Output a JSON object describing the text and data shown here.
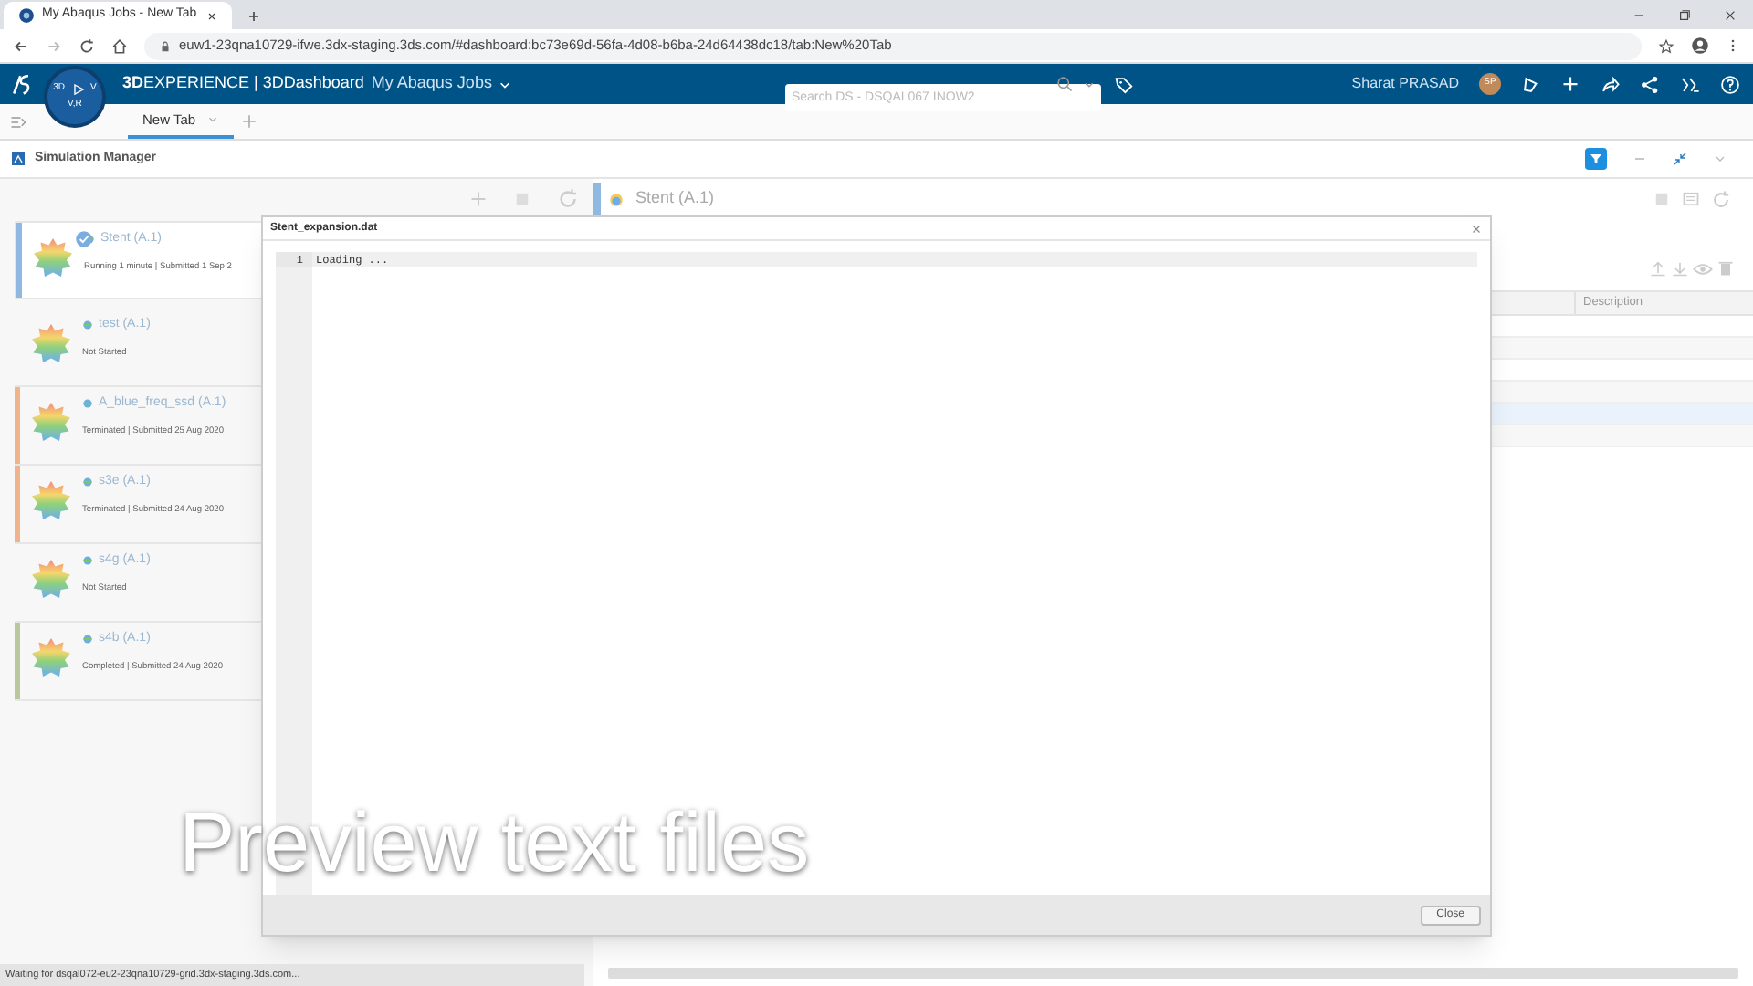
{
  "browser": {
    "tab_title": "My Abaqus Jobs - New Tab",
    "url": "euw1-23qna10729-ifwe.3dx-staging.3ds.com/#dashboard:bc73e69d-56fa-4d08-b6ba-24d64438dc18/tab:New%20Tab"
  },
  "topbar": {
    "brand_bold": "3D",
    "brand_rest": "EXPERIENCE | 3DDashboard",
    "dashboard": "My Abaqus Jobs",
    "search_placeholder": "Search DS - DSQAL067 INOW2",
    "user": "Sharat PRASAD",
    "initials": "SP",
    "compass_left": "3D",
    "compass_right": "V",
    "compass_bottom": "V,R"
  },
  "dashboard_tabs": [
    {
      "label": "New Tab",
      "selected": true
    }
  ],
  "widget": {
    "title": "Simulation Manager"
  },
  "jobs": [
    {
      "name": "Stent (A.1)",
      "status": "Running 1 minute | Submitted 1 Sep 2",
      "selected": true,
      "color": "#8fb9e0"
    },
    {
      "name": "test (A.1)",
      "status": "Not Started",
      "selected": false
    },
    {
      "name": "A_blue_freq_ssd (A.1)",
      "status": "Terminated | Submitted 25 Aug 2020",
      "selected": false,
      "color": "#f0b48c"
    },
    {
      "name": "s3e (A.1)",
      "status": "Terminated | Submitted 24 Aug 2020",
      "selected": false,
      "color": "#f0b48c"
    },
    {
      "name": "s4g (A.1)",
      "status": "Not Started",
      "selected": false
    },
    {
      "name": "s4b (A.1)",
      "status": "Completed | Submitted 24 Aug 2020",
      "selected": false,
      "color": "#b8c79c"
    }
  ],
  "detail": {
    "title": "Stent (A.1)",
    "table_columns": [
      "Description"
    ]
  },
  "dialog": {
    "title": "Stent_expansion.dat",
    "lines": [
      {
        "number": "1",
        "text": "Loading ..."
      }
    ],
    "close_button": "Close"
  },
  "caption": "Preview text files",
  "status_bar": "Waiting for dsqal072-eu2-23qna10729-grid.3dx-staging.3ds.com..."
}
